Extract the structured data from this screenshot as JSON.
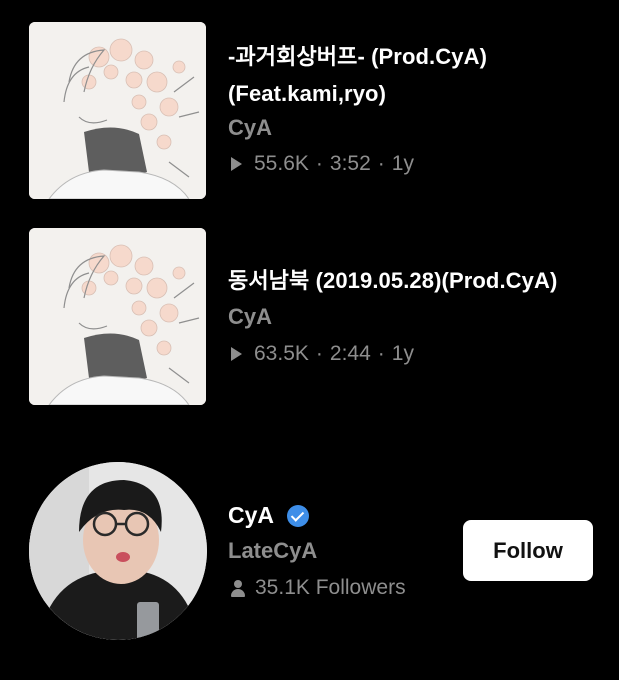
{
  "tracks": [
    {
      "title_line1": "-과거회상버프- (Prod.CyA)",
      "title_line2": "(Feat.kami,ryo)",
      "artist": "CyA",
      "plays": "55.6K",
      "duration": "3:52",
      "age": "1y",
      "icon": "play-icon"
    },
    {
      "title_line1": "동서남북 (2019.05.28)(Prod.CyA)",
      "artist": "CyA",
      "plays": "63.5K",
      "duration": "2:44",
      "age": "1y",
      "icon": "play-icon"
    }
  ],
  "artist_card": {
    "name": "CyA",
    "verified_icon": "verified-badge-icon",
    "handle": "LateCyA",
    "followers": "35.1K Followers",
    "followers_icon": "person-icon",
    "follow_label": "Follow"
  },
  "meta_separator": "·",
  "colors": {
    "background": "#000000",
    "primary_text": "#ffffff",
    "secondary_text": "#8e8e8e",
    "verified": "#3e8ee8",
    "button_bg": "#ffffff",
    "button_text": "#111111"
  }
}
